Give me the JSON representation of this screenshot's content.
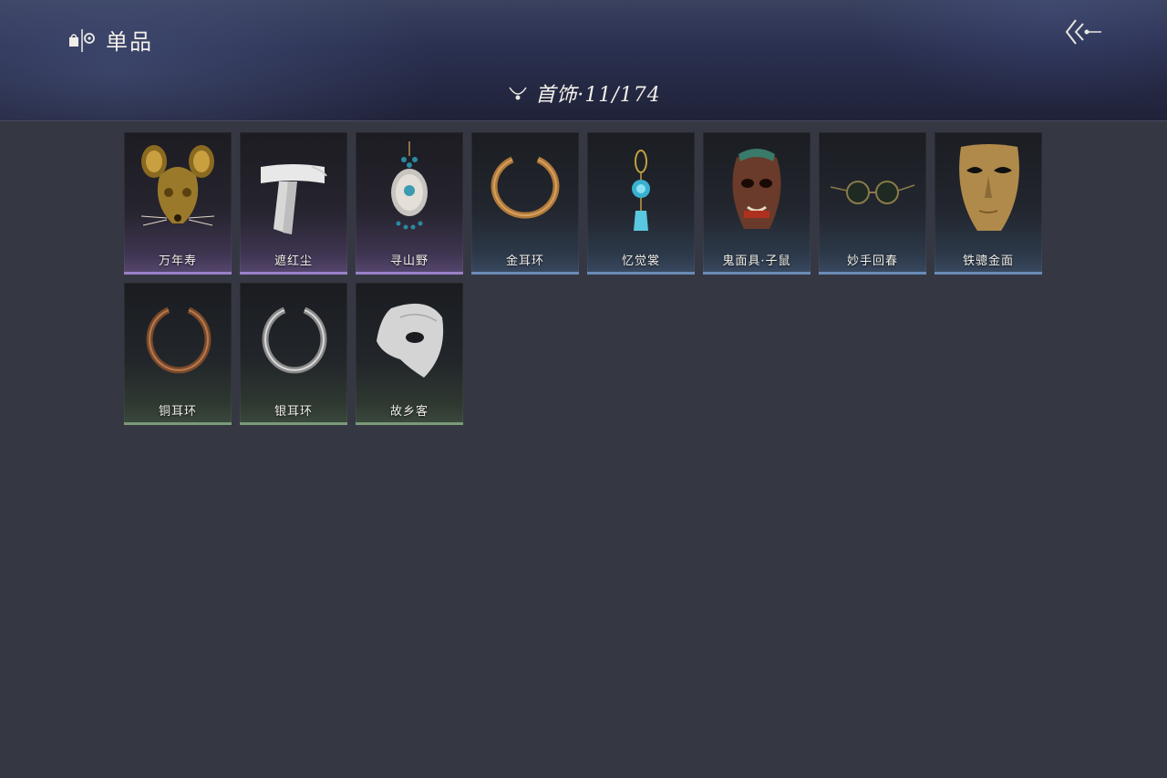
{
  "header": {
    "title": "单品",
    "brand_icon": "shop-bag-icon",
    "back_icon": "double-chevron-back-icon"
  },
  "category": {
    "icon": "necklace-icon",
    "label": "首饰·11/174"
  },
  "items": [
    {
      "name": "万年寿",
      "rarity": "purple",
      "icon": "golden-rat-mask-icon"
    },
    {
      "name": "遮红尘",
      "rarity": "purple",
      "icon": "white-blindfold-icon"
    },
    {
      "name": "寻山野",
      "rarity": "purple",
      "icon": "ornate-pendant-icon"
    },
    {
      "name": "金耳环",
      "rarity": "blue",
      "icon": "gold-earring-icon"
    },
    {
      "name": "忆觉裳",
      "rarity": "blue",
      "icon": "blue-gem-pendant-icon"
    },
    {
      "name": "鬼面具·子鼠",
      "rarity": "blue",
      "icon": "demon-mask-icon"
    },
    {
      "name": "妙手回春",
      "rarity": "blue",
      "icon": "round-glasses-icon"
    },
    {
      "name": "铁骢金面",
      "rarity": "blue",
      "icon": "gold-face-mask-icon"
    },
    {
      "name": "铜耳环",
      "rarity": "green",
      "icon": "copper-earring-icon"
    },
    {
      "name": "银耳环",
      "rarity": "green",
      "icon": "silver-earring-icon"
    },
    {
      "name": "故乡客",
      "rarity": "green",
      "icon": "white-half-mask-icon"
    }
  ],
  "colors": {
    "background": "#353842",
    "purple_rarity": "#9a80c8",
    "blue_rarity": "#6a8cb8",
    "green_rarity": "#7a9a7a"
  }
}
